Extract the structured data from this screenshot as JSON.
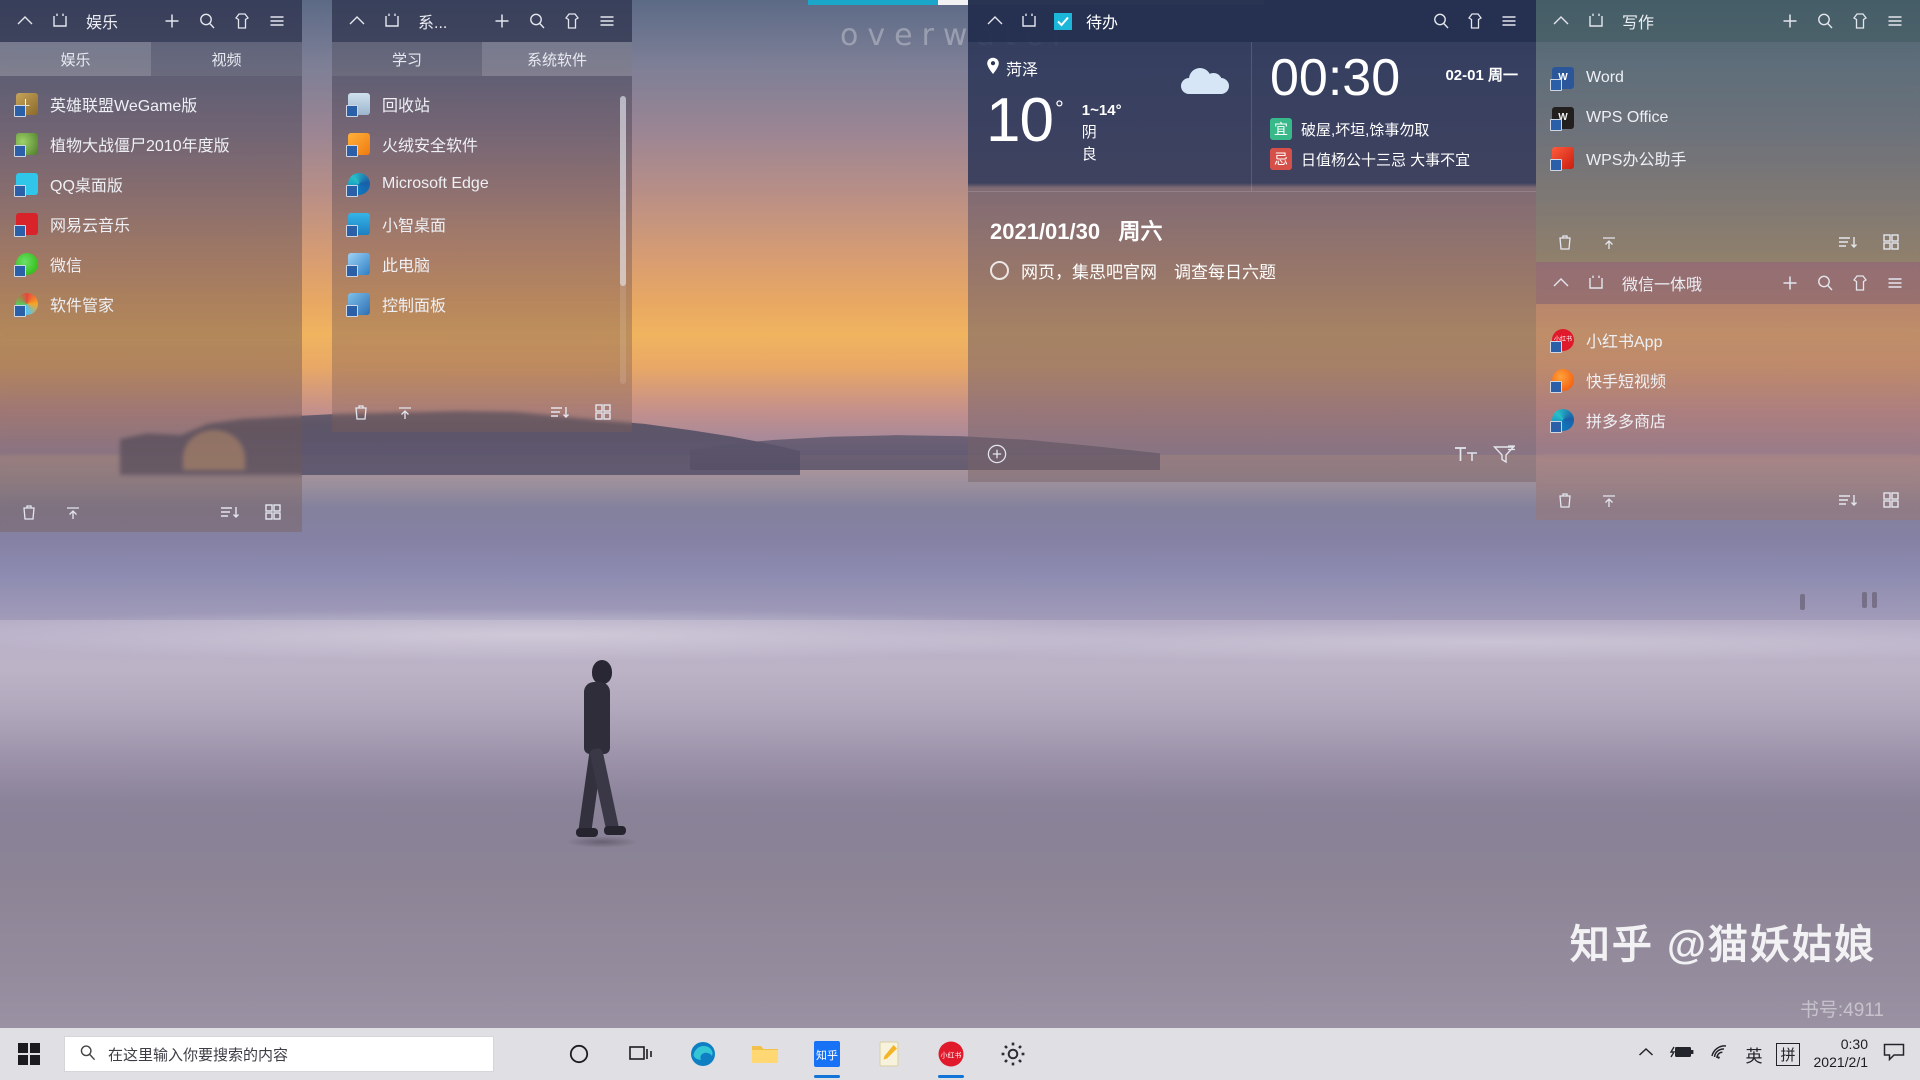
{
  "wallpaper": {
    "watermark_text": "overwater"
  },
  "panels": [
    {
      "id": "entertainment",
      "title": "娱乐",
      "header_icons": [
        "chevron-up-icon",
        "box-icon",
        "plus-icon",
        "search-icon",
        "shirt-icon",
        "menu-icon"
      ],
      "tabs": [
        {
          "label": "娱乐",
          "active": true
        },
        {
          "label": "视频",
          "active": false
        }
      ],
      "items": [
        {
          "label": "英雄联盟WeGame版",
          "icon": "lol-icon",
          "color": "#2d2a22",
          "glyph": "L"
        },
        {
          "label": "植物大战僵尸2010年度版",
          "icon": "pvz-icon",
          "color": "#4a5a2e",
          "glyph": ""
        },
        {
          "label": "QQ桌面版",
          "icon": "qq-icon",
          "color": "#29c2e8",
          "glyph": ""
        },
        {
          "label": "网易云音乐",
          "icon": "netease-music-icon",
          "color": "#d61e23",
          "glyph": ""
        },
        {
          "label": "微信",
          "icon": "wechat-icon",
          "color": "#2dc100",
          "glyph": ""
        },
        {
          "label": "软件管家",
          "icon": "software-manager-icon",
          "color": "#eceff4",
          "glyph": ""
        }
      ],
      "footer_icons": [
        "trash-icon",
        "collapse-icon",
        "sort-icon",
        "grid-icon"
      ]
    },
    {
      "id": "system",
      "title": "系...",
      "header_icons": [
        "chevron-up-icon",
        "box-icon",
        "plus-icon",
        "search-icon",
        "shirt-icon",
        "menu-icon"
      ],
      "tabs": [
        {
          "label": "学习",
          "active": false
        },
        {
          "label": "系统软件",
          "active": true
        }
      ],
      "items": [
        {
          "label": "回收站",
          "icon": "recycle-bin-icon",
          "color": "#b9c6d4",
          "glyph": ""
        },
        {
          "label": "火绒安全软件",
          "icon": "huorong-icon",
          "color": "#f08a1b",
          "glyph": ""
        },
        {
          "label": "Microsoft Edge",
          "icon": "edge-icon",
          "color": "#1a7fd4",
          "glyph": ""
        },
        {
          "label": "小智桌面",
          "icon": "xiaozhi-desktop-icon",
          "color": "#1d9ae0",
          "glyph": ""
        },
        {
          "label": "此电脑",
          "icon": "this-pc-icon",
          "color": "#4a9fe0",
          "glyph": ""
        },
        {
          "label": "控制面板",
          "icon": "control-panel-icon",
          "color": "#3a7fc4",
          "glyph": ""
        }
      ],
      "footer_icons": [
        "trash-icon",
        "collapse-icon",
        "sort-icon",
        "grid-icon"
      ]
    },
    {
      "id": "writing",
      "title": "写作",
      "header_icons": [
        "chevron-up-icon",
        "box-icon",
        "plus-icon",
        "search-icon",
        "shirt-icon",
        "menu-icon"
      ],
      "tabs": [],
      "items": [
        {
          "label": "Word",
          "icon": "word-icon",
          "color": "#2b579a",
          "glyph": "W"
        },
        {
          "label": "WPS Office",
          "icon": "wps-office-icon",
          "color": "#231f1e",
          "glyph": "W"
        },
        {
          "label": "WPS办公助手",
          "icon": "wps-assistant-icon",
          "color": "#e8412e",
          "glyph": ""
        }
      ],
      "footer_icons": [
        "trash-icon",
        "collapse-icon",
        "sort-icon",
        "grid-icon"
      ]
    },
    {
      "id": "wechat",
      "title": "微信一体哦",
      "header_icons": [
        "chevron-up-icon",
        "box-icon",
        "plus-icon",
        "search-icon",
        "shirt-icon",
        "menu-icon"
      ],
      "tabs": [],
      "items": [
        {
          "label": "小红书App",
          "icon": "xiaohongshu-icon",
          "color": "#e0192b",
          "glyph": "小红书"
        },
        {
          "label": "快手短视频",
          "icon": "kuaishou-icon",
          "color": "#f25106",
          "glyph": ""
        },
        {
          "label": "拼多多商店",
          "icon": "pinduoduo-icon",
          "color": "#2b88d8",
          "glyph": ""
        }
      ],
      "footer_icons": [
        "trash-icon",
        "collapse-icon",
        "sort-icon",
        "grid-icon"
      ]
    }
  ],
  "widget": {
    "header": {
      "title": "待办",
      "icons": [
        "chevron-up-icon",
        "box-icon",
        "todo-check-icon",
        "search-icon",
        "shirt-icon",
        "menu-icon"
      ]
    },
    "weather": {
      "city": "菏泽",
      "location_icon": "map-pin-icon",
      "condition_icon": "cloudy-icon",
      "temperature": "10",
      "degree_symbol": "°",
      "range": "1~14",
      "range_degree": "°",
      "condition": "阴",
      "air_quality": "良"
    },
    "clock": {
      "time": "00:30",
      "date": "02-01 周一",
      "almanac": [
        {
          "badge": "宜",
          "badge_color": "#37b98a",
          "text": "破屋,坏垣,馀事勿取"
        },
        {
          "badge": "忌",
          "badge_color": "#d6504a",
          "text": "日值杨公十三忌 大事不宜"
        }
      ]
    },
    "todo": {
      "date": "2021/01/30",
      "weekday": "周六",
      "items": [
        {
          "text": "网页，集思吧官网　调查每日六题",
          "done": false
        }
      ],
      "footer_icons": [
        "add-circle-icon",
        "text-format-icon",
        "filter-icon"
      ]
    }
  },
  "watermarks": {
    "zhihu": "知乎 @猫妖姑娘",
    "zhihu_id": "书号:4911"
  },
  "taskbar": {
    "start_icon": "windows-start-icon",
    "search": {
      "placeholder": "在这里输入你要搜索的内容",
      "icon": "search-icon"
    },
    "buttons": [
      {
        "name": "cortana-icon",
        "running": false
      },
      {
        "name": "task-view-icon",
        "running": false
      },
      {
        "name": "edge-icon",
        "running": false
      },
      {
        "name": "file-explorer-icon",
        "running": false
      },
      {
        "name": "zhihu-icon",
        "running": true
      },
      {
        "name": "notepad-icon",
        "running": false
      },
      {
        "name": "xiaohongshu-icon",
        "running": true
      },
      {
        "name": "settings-icon",
        "running": false
      }
    ],
    "tray": {
      "overflow_icon": "chevron-up-icon",
      "battery_icon": "battery-charging-icon",
      "network_icon": "wifi-icon",
      "ime_lang": "英",
      "ime_mode": "拼",
      "time": "0:30",
      "date": "2021/2/1",
      "notification_icon": "speech-bubble-icon"
    }
  }
}
